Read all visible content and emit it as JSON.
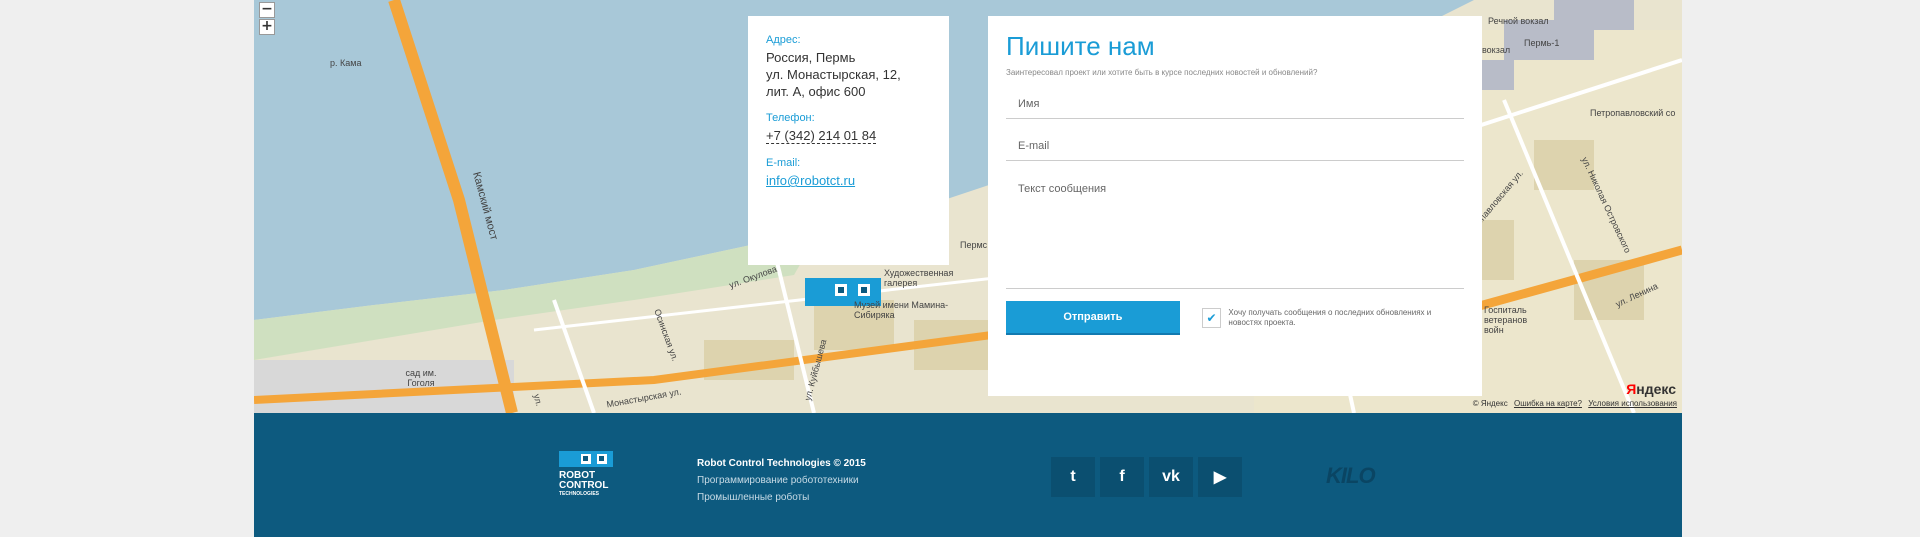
{
  "map": {
    "zoom_out": "−",
    "zoom_in": "+",
    "labels": {
      "kama": "р. Кама",
      "kamsky_bridge": "Камский мост",
      "okulova": "ул. Окулова",
      "monastyrskaya": "Монастырская ул.",
      "kuibysheva": "ул. Куйбышева",
      "osinskaya": "Осинская ул.",
      "garden": "сад им. Гоголя",
      "gallery": "Художественная галерея",
      "museum": "Музей имени Мамина-Сибиряка",
      "petropavlovskaya": "Петропавловская ул.",
      "nikolay_ostrovsky": "ул. Николая Островского",
      "lenina": "ул. Ленина",
      "perm1": "Пермь-1",
      "vokzal": "вокзал",
      "rechnoy": "Речной вокзал",
      "permskaya": "Пермс",
      "hospital": "Госпиталь ветеранов войн",
      "petropavl_sobor": "Петропавловский со",
      "ul": "ул."
    },
    "copyright": "© Яндекс",
    "error_link": "Ошибка на карте?",
    "terms_link": "Условия использования",
    "yandex_ya": "Я",
    "yandex_rest": "ндекс",
    "colors": {
      "water": "#a8c8d8",
      "land": "#e9e4cf",
      "road": "#f4a53a"
    }
  },
  "contact": {
    "address_label": "Адрес:",
    "address_line1": "Россия, Пермь",
    "address_line2": "ул. Монастырская, 12,",
    "address_line3": "лит. А, офис 600",
    "phone_label": "Телефон:",
    "phone": "+7 (342) 214 01 84",
    "email_label": "E-mail:",
    "email": "info@robotct.ru"
  },
  "form": {
    "title": "Пишите нам",
    "subtitle": "Заинтересовал проект или хотите быть в курсе последних новостей и обновлений?",
    "name_placeholder": "Имя",
    "email_placeholder": "E-mail",
    "message_placeholder": "Текст сообщения",
    "submit": "Отправить",
    "checkbox_mark": "✔",
    "checkbox_label": "Хочу получать сообщения о последних обновлениях и новостях проекта."
  },
  "footer": {
    "logo_line1": "ROBOT",
    "logo_line2": "CONTROL",
    "logo_line3": "TECHNOLOGIES",
    "company": "Robot Control Technologies © 2015",
    "link1": "Программирование робототехники",
    "link2": "Промышленные роботы",
    "social": {
      "twitter": "t",
      "facebook": "f",
      "vk": "vk",
      "youtube": "▶"
    },
    "kilo": "KILO"
  }
}
